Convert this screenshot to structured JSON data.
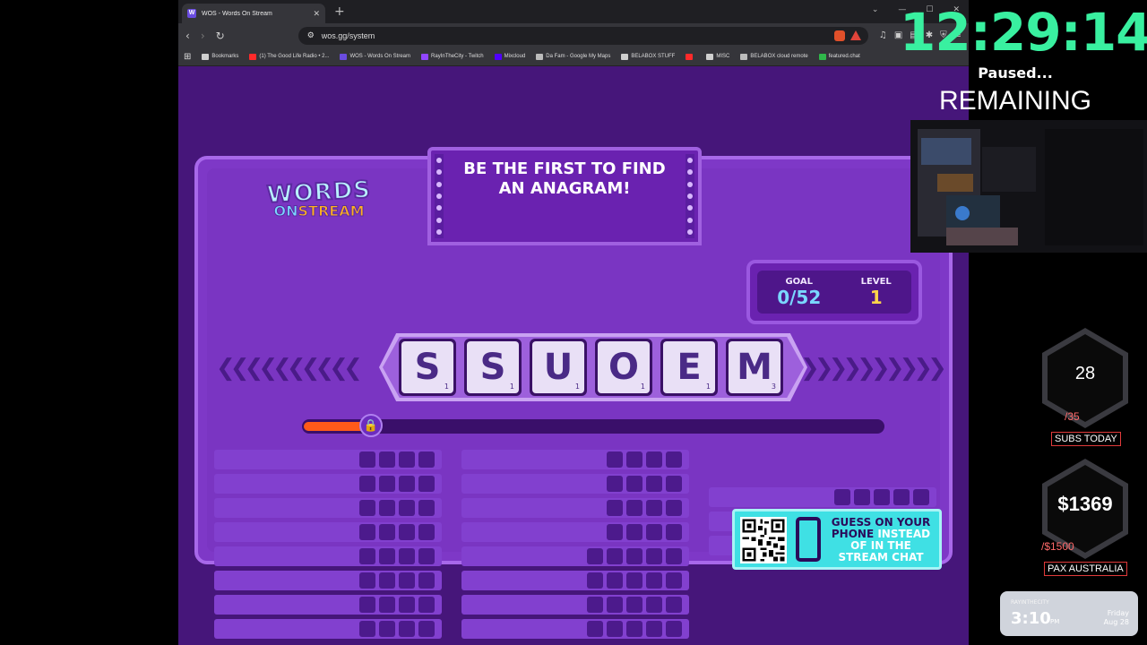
{
  "browser": {
    "tab_title": "WOS - Words On Stream",
    "tab_favicon": "W",
    "url": "wos.gg/system",
    "bookmarks": [
      {
        "label": "Bookmarks",
        "icon": "folder-icon"
      },
      {
        "label": "(1) The Good Life Radio • 2...",
        "icon": "youtube-icon"
      },
      {
        "label": "WOS - Words On Stream",
        "icon": "wos-icon"
      },
      {
        "label": "RayInTheCity - Twitch",
        "icon": "twitch-icon"
      },
      {
        "label": "Mixcloud",
        "icon": "mixcloud-icon"
      },
      {
        "label": "Da Fam - Google My Maps",
        "icon": "maps-icon"
      },
      {
        "label": "BELABOX STUFF",
        "icon": "folder-icon"
      },
      {
        "label": "",
        "icon": "youtube-icon"
      },
      {
        "label": "MISC",
        "icon": "folder-icon"
      },
      {
        "label": "BELABOX cloud remote",
        "icon": "globe-icon"
      },
      {
        "label": "featured.chat",
        "icon": "chat-icon"
      }
    ]
  },
  "game": {
    "logo_words": "WORDS",
    "logo_on": "ON",
    "logo_stream": "STREAM",
    "banner_line1": "BE THE FIRST TO FIND",
    "banner_line2": "AN ANAGRAM!",
    "goal_label": "GOAL",
    "goal_value": "0/52",
    "level_label": "LEVEL",
    "level_value": "1",
    "tiles": [
      {
        "letter": "S",
        "points": "1"
      },
      {
        "letter": "S",
        "points": "1"
      },
      {
        "letter": "U",
        "points": "1"
      },
      {
        "letter": "O",
        "points": "1"
      },
      {
        "letter": "E",
        "points": "1"
      },
      {
        "letter": "M",
        "points": "3"
      }
    ],
    "progress_fraction": 0.12,
    "qr_line1": "GUESS ON YOUR",
    "qr_line2a": "PHONE",
    "qr_line2b": "INSTEAD",
    "qr_line3": "OF IN THE",
    "qr_line4": "STREAM CHAT"
  },
  "overlay": {
    "timer": "12:29:14",
    "paused": "Paused...",
    "remaining": "REMAINING",
    "subs_value": "28",
    "subs_target": "/35",
    "subs_label": "SUBS TODAY",
    "money_value": "$1369",
    "money_target": "/$1500",
    "money_label": "PAX AUSTRALIA",
    "clock_handle": "RAYINTHECITY",
    "clock_time": "3:10",
    "clock_ampm": "PM",
    "clock_dow": "Friday",
    "clock_date": "Aug 28"
  },
  "colors": {
    "timer": "#39f0a0",
    "board": "#7e38c7",
    "accent_cyan": "#3fe0e4",
    "progress": "#ff5a1a"
  }
}
